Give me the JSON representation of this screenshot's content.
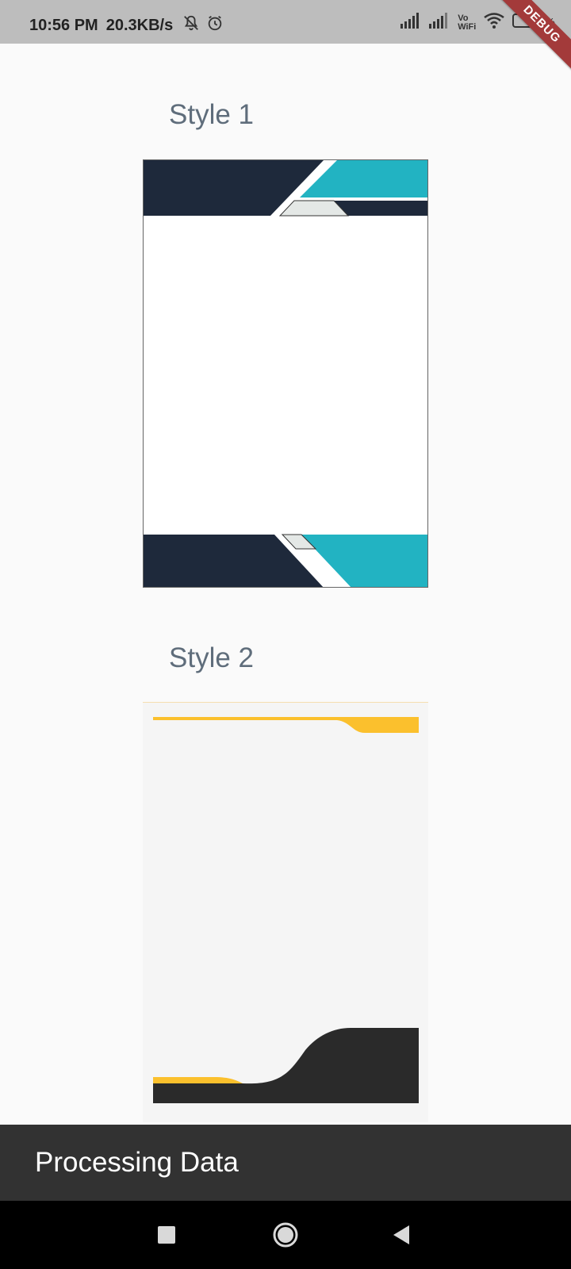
{
  "status_bar": {
    "time": "10:56 PM",
    "network_speed": "20.3KB/s",
    "icons": [
      "bell-off-icon",
      "alarm-icon",
      "signal-icon",
      "signal-icon",
      "vowifi-icon",
      "wifi-icon",
      "battery-icon"
    ],
    "vowifi_top": "Vo",
    "vowifi_bottom": "WiFi",
    "battery": "3%"
  },
  "debug_banner": "DEBUG",
  "styles": [
    {
      "title": "Style 1"
    },
    {
      "title": "Style 2"
    }
  ],
  "snackbar": {
    "message": "Processing Data"
  },
  "nav": {
    "icons": [
      "recents-icon",
      "home-icon",
      "back-icon"
    ]
  },
  "colors": {
    "style1_navy": "#1e293b",
    "style1_teal": "#22b3c2",
    "style2_yellow": "#fbc02d",
    "style2_dark": "#2a2a2a",
    "snackbar_bg": "#323232"
  }
}
